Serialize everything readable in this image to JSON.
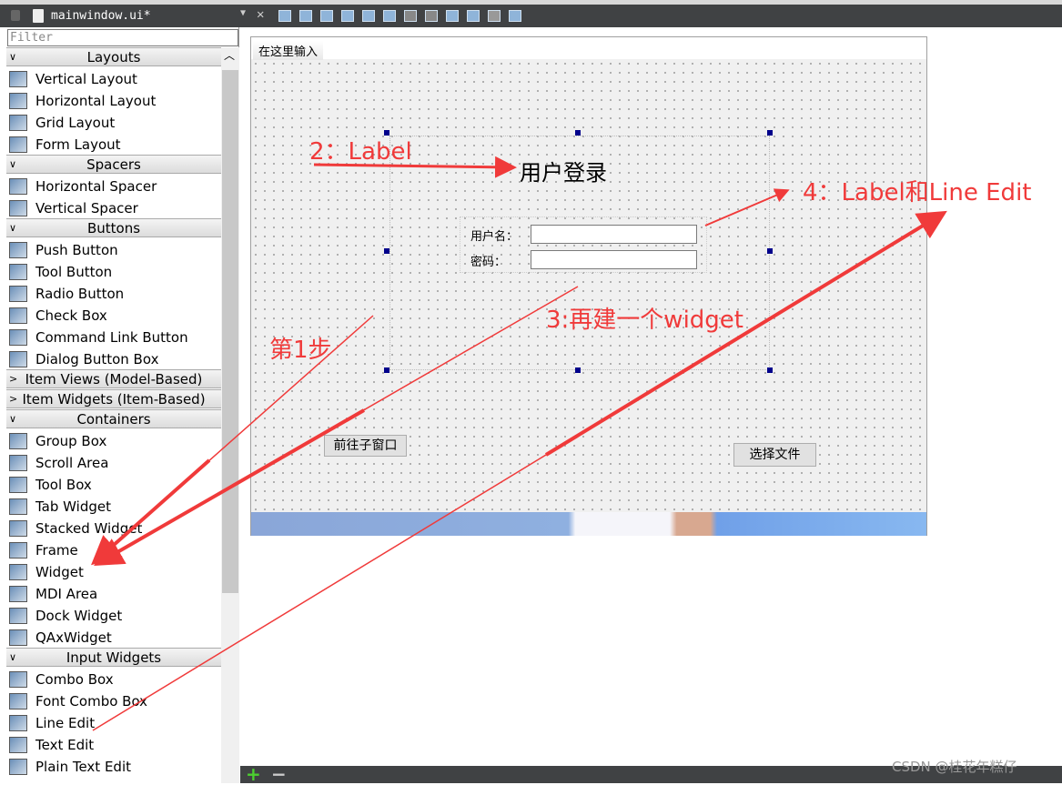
{
  "toolbar": {
    "filename": "mainwindow.ui*"
  },
  "sidebar": {
    "filter_placeholder": "Filter",
    "sections": [
      {
        "title": "Layouts",
        "expanded": true,
        "items": [
          "Vertical Layout",
          "Horizontal Layout",
          "Grid Layout",
          "Form Layout"
        ]
      },
      {
        "title": "Spacers",
        "expanded": true,
        "items": [
          "Horizontal Spacer",
          "Vertical Spacer"
        ]
      },
      {
        "title": "Buttons",
        "expanded": true,
        "items": [
          "Push Button",
          "Tool Button",
          "Radio Button",
          "Check Box",
          "Command Link Button",
          "Dialog Button Box"
        ]
      },
      {
        "title": "Item Views (Model-Based)",
        "expanded": false,
        "items": []
      },
      {
        "title": "Item Widgets (Item-Based)",
        "expanded": false,
        "items": []
      },
      {
        "title": "Containers",
        "expanded": true,
        "items": [
          "Group Box",
          "Scroll Area",
          "Tool Box",
          "Tab Widget",
          "Stacked Widget",
          "Frame",
          "Widget",
          "MDI Area",
          "Dock Widget",
          "QAxWidget"
        ]
      },
      {
        "title": "Input Widgets",
        "expanded": true,
        "items": [
          "Combo Box",
          "Font Combo Box",
          "Line Edit",
          "Text Edit",
          "Plain Text Edit"
        ]
      }
    ]
  },
  "form": {
    "menu_item": "在这里输入",
    "title_label": "用户登录",
    "username_label": "用户名：",
    "password_label": "密码：",
    "username_value": "",
    "password_value": "",
    "goto_child_button": "前往子窗口",
    "select_file_button": "选择文件"
  },
  "annotations": {
    "step1": "第1步",
    "step2": "2：Label",
    "step3": "3:再建一个widget",
    "step4": "4：Label和Line Edit",
    "color": "#f03a3a"
  },
  "watermark": "CSDN @桂花年糕仔"
}
